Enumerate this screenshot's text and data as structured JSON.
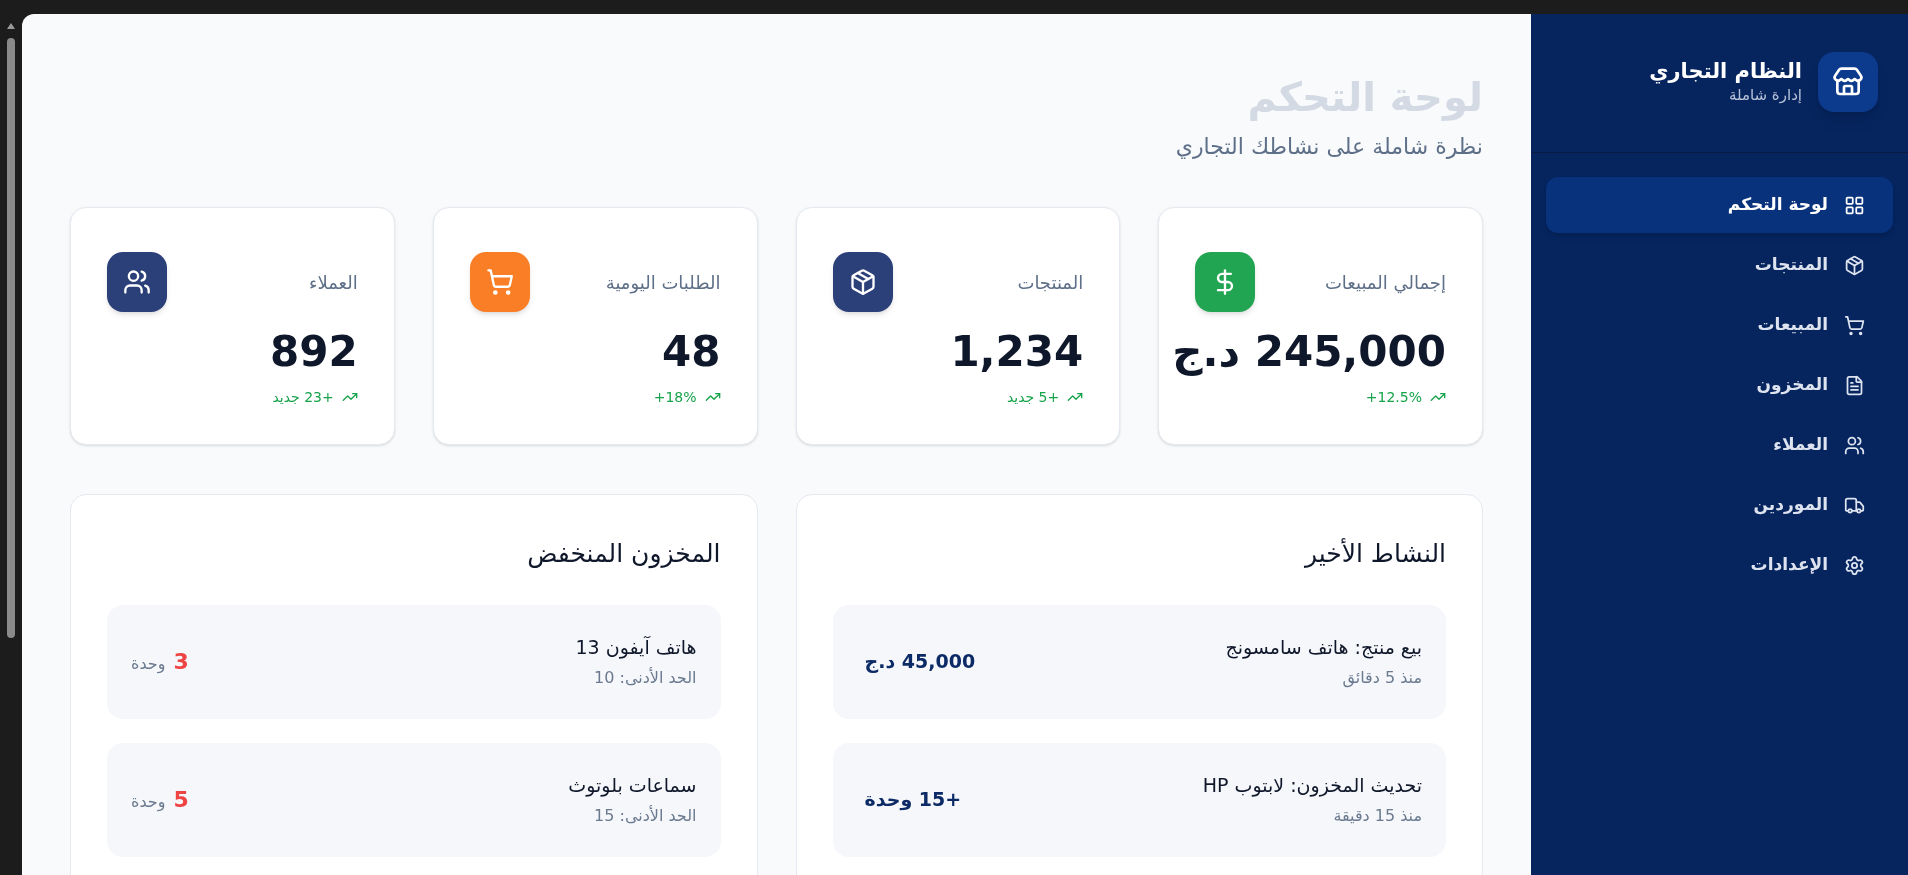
{
  "sidebar": {
    "title": "النظام التجاري",
    "subtitle": "إدارة شاملة",
    "items": [
      {
        "label": "لوحة التحكم",
        "kind": "grid",
        "selected": true
      },
      {
        "label": "المنتجات",
        "kind": "package",
        "selected": false
      },
      {
        "label": "المبيعات",
        "kind": "cart",
        "selected": false
      },
      {
        "label": "المخزون",
        "kind": "file",
        "selected": false
      },
      {
        "label": "العملاء",
        "kind": "users",
        "selected": false
      },
      {
        "label": "الموردين",
        "kind": "truck",
        "selected": false
      },
      {
        "label": "الإعدادات",
        "kind": "gear",
        "selected": false
      }
    ]
  },
  "header": {
    "title": "لوحة التحكم",
    "subtitle": "نظرة شاملة على نشاطك التجاري"
  },
  "stats": [
    {
      "label": "إجمالي المبيعات",
      "value": "245,000 د.ج",
      "trend": "12.5%+",
      "kind": "dollar",
      "color": "#22a552"
    },
    {
      "label": "المنتجات",
      "value": "1,234",
      "trend": "+5 جديد",
      "kind": "package",
      "color": "#2b3f78"
    },
    {
      "label": "الطلبات اليومية",
      "value": "48",
      "trend": "18%+",
      "kind": "cart",
      "color": "#f97e25"
    },
    {
      "label": "العملاء",
      "value": "892",
      "trend": "+23 جديد",
      "kind": "users",
      "color": "#2b3f78"
    }
  ],
  "recent_activity": {
    "title": "النشاط الأخير",
    "items": [
      {
        "title": "بيع منتج: هاتف سامسونج",
        "time": "منذ 5 دقائق",
        "amount": "45,000 د.ج"
      },
      {
        "title": "تحديث المخزون: لابتوب HP",
        "time": "منذ 15 دقيقة",
        "amount": "+15 وحدة"
      }
    ]
  },
  "low_stock": {
    "title": "المخزون المنخفض",
    "items": [
      {
        "name": "هاتف آيفون 13",
        "minimum": "الحد الأدنى: 10",
        "quantity": "3",
        "unit": "وحدة"
      },
      {
        "name": "سماعات بلوتوث",
        "minimum": "الحد الأدنى: 15",
        "quantity": "5",
        "unit": "وحدة"
      }
    ]
  }
}
